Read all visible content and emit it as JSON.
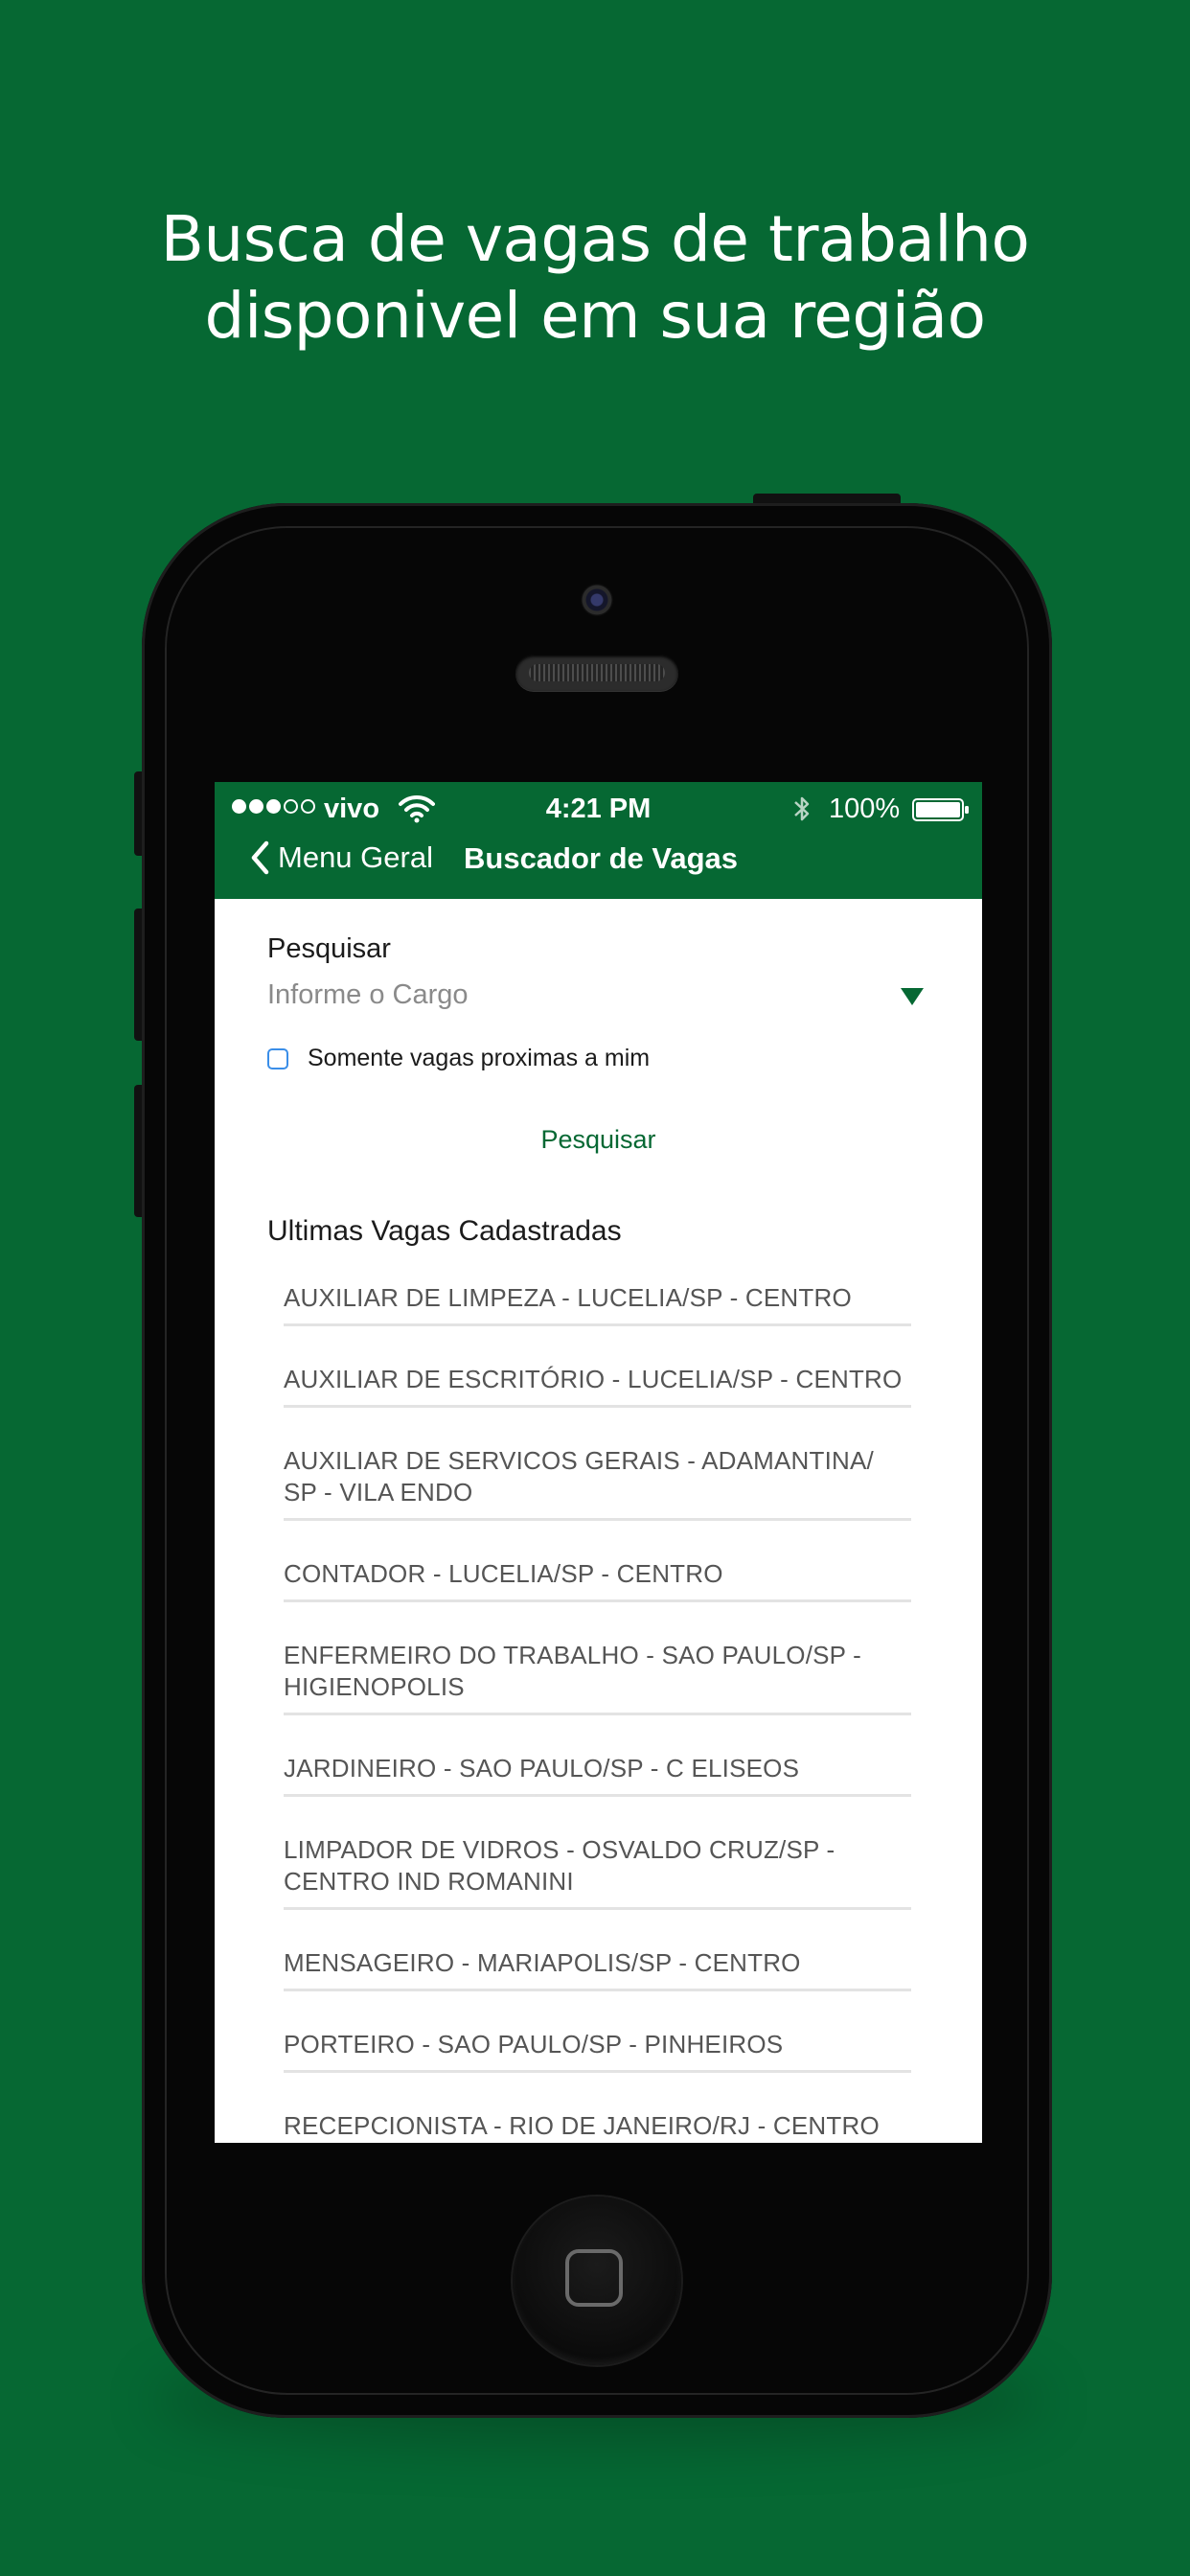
{
  "headline": {
    "line1": "Busca de vagas de trabalho",
    "line2": "disponivel em sua região"
  },
  "status_bar": {
    "carrier": "vivo",
    "time": "4:21 PM",
    "battery": "100%",
    "signal_filled": 3,
    "signal_total": 5
  },
  "nav": {
    "back_label": "Menu Geral",
    "title": "Buscador de Vagas"
  },
  "search": {
    "label": "Pesquisar",
    "placeholder": "Informe o Cargo",
    "near_me_label": "Somente vagas proximas a mim",
    "near_me_checked": false,
    "button_label": "Pesquisar"
  },
  "latest": {
    "title": "Ultimas Vagas Cadastradas",
    "jobs": [
      "AUXILIAR DE LIMPEZA - LUCELIA/SP - CENTRO",
      "AUXILIAR DE ESCRITÓRIO - LUCELIA/SP - CENTRO",
      "AUXILIAR DE SERVICOS GERAIS - ADAMANTINA/\nSP - VILA ENDO",
      "CONTADOR - LUCELIA/SP - CENTRO",
      "ENFERMEIRO DO TRABALHO - SAO PAULO/SP -\nHIGIENOPOLIS",
      "JARDINEIRO - SAO PAULO/SP - C ELISEOS",
      "LIMPADOR DE VIDROS - OSVALDO CRUZ/SP -\nCENTRO IND ROMANINI",
      "MENSAGEIRO - MARIAPOLIS/SP - CENTRO",
      "PORTEIRO - SAO PAULO/SP - PINHEIROS",
      "RECEPCIONISTA - RIO DE JANEIRO/RJ - CENTRO"
    ]
  },
  "colors": {
    "brand_green": "#066833",
    "checkbox_blue": "#3a8ee8",
    "job_text": "#555555"
  },
  "icons": {
    "back": "chevron-left-icon",
    "wifi": "wifi-icon",
    "bluetooth": "bluetooth-icon",
    "battery": "battery-icon",
    "dropdown": "triangle-down-icon"
  }
}
